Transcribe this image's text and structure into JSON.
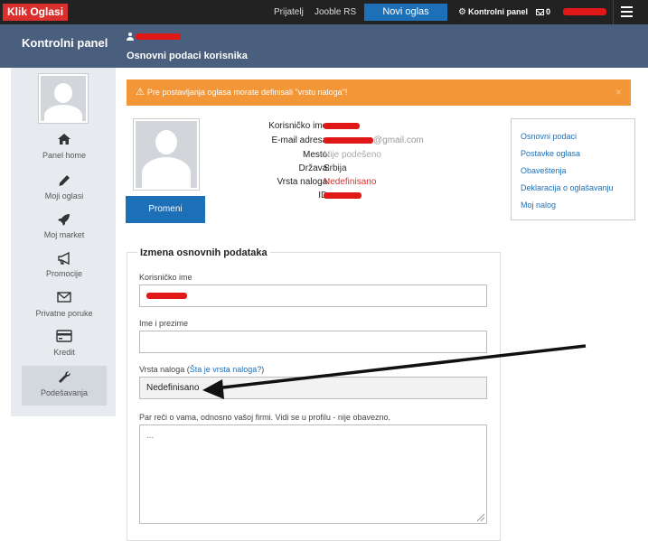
{
  "topbar": {
    "logo": "Klik Oglasi",
    "nav_prijatelj": "Prijatelj",
    "nav_jooble": "Jooble RS",
    "novi_oglas": "Novi oglas",
    "kontrolni_panel": "Kontrolni panel",
    "message_count": "0",
    "gear_icon": "gear-icon",
    "envelope_icon": "envelope-icon",
    "menu_icon": "hamburger-icon"
  },
  "header": {
    "title": "Kontrolni panel",
    "subtitle": "Osnovni podaci korisnika"
  },
  "sidebar": {
    "items": [
      {
        "label": "Panel home",
        "icon": "home-icon"
      },
      {
        "label": "Moji oglasi",
        "icon": "pencil-icon"
      },
      {
        "label": "Moj market",
        "icon": "rocket-icon"
      },
      {
        "label": "Promocije",
        "icon": "megaphone-icon"
      },
      {
        "label": "Privatne poruke",
        "icon": "envelope-icon"
      },
      {
        "label": "Kredit",
        "icon": "credit-card-icon"
      },
      {
        "label": "Podešavanja",
        "icon": "wrench-icon"
      }
    ],
    "active": "Podešavanja"
  },
  "alert": {
    "text": "Pre postavljanja oglasa morate definisali \"vrstu naloga\"!",
    "close": "×"
  },
  "profile": {
    "change_button": "Promeni",
    "fields": {
      "username_label": "Korisničko ime:",
      "email_label": "E-mail adresa:",
      "email_visible": "@gmail.com",
      "mesto_label": "Mesto:",
      "mesto_value": "Nije podešeno",
      "drzava_label": "Država:",
      "drzava_value": "Srbija",
      "vrsta_label": "Vrsta naloga:",
      "vrsta_value": "Nedefinisano",
      "id_label": "ID:"
    }
  },
  "right_menu": {
    "links": [
      "Osnovni podaci",
      "Postavke oglasa",
      "Obaveštenja",
      "Deklaracija o oglašavanju",
      "Moj nalog"
    ]
  },
  "form": {
    "legend": "Izmena osnovnih podataka",
    "username_label": "Korisničko ime",
    "fullname_label": "Ime i prezime",
    "fullname_value": "",
    "vrsta_label_prefix": "Vrsta naloga (",
    "vrsta_link": "Šta je vrsta naloga?",
    "vrsta_label_suffix": ")",
    "vrsta_value": "Nedefinisano",
    "about_label": "Par reči o vama, odnosno vašoj firmi. Vidi se u profilu - nije obavezno.",
    "about_placeholder": "..."
  },
  "colors": {
    "topbar": "#222222",
    "logo": "#d9302e",
    "primary": "#1d6fb8",
    "header": "#4a5e7d",
    "alert": "#f29637",
    "redaction": "#e01818"
  }
}
